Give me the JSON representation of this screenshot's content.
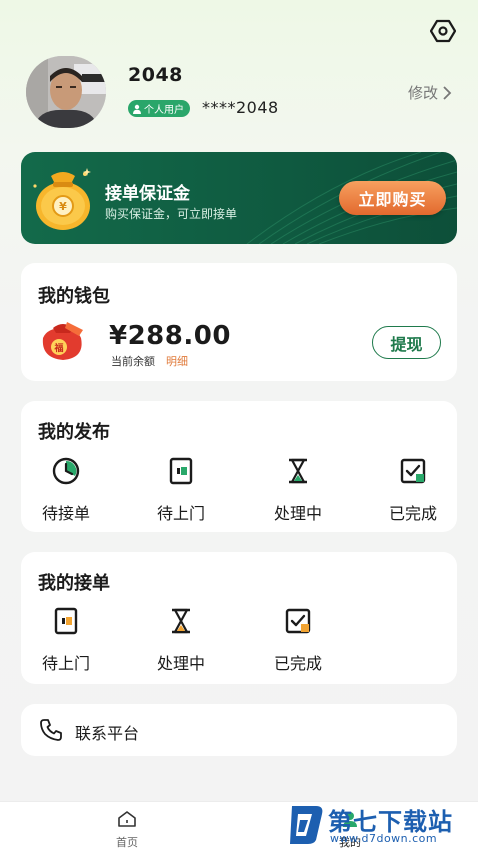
{
  "profile": {
    "name": "2048",
    "badge": "个人用户",
    "phone": "****2048",
    "edit_label": "修改"
  },
  "deposit_banner": {
    "title": "接单保证金",
    "subtitle": "购买保证金，可立即接单",
    "button_label": "立即购买"
  },
  "wallet": {
    "title": "我的钱包",
    "amount": "¥288.00",
    "balance_label": "当前余额",
    "detail_label": "明细",
    "withdraw_label": "提现"
  },
  "my_posts": {
    "title": "我的发布",
    "items": [
      {
        "label": "待接单",
        "icon": "clock-icon"
      },
      {
        "label": "待上门",
        "icon": "door-icon"
      },
      {
        "label": "处理中",
        "icon": "hourglass-icon"
      },
      {
        "label": "已完成",
        "icon": "check-box-icon"
      }
    ]
  },
  "my_orders": {
    "title": "我的接单",
    "items": [
      {
        "label": "待上门",
        "icon": "door-icon"
      },
      {
        "label": "处理中",
        "icon": "hourglass-icon"
      },
      {
        "label": "已完成",
        "icon": "check-box-icon"
      }
    ]
  },
  "contact": {
    "label": "联系平台",
    "icon": "phone-icon"
  },
  "tabbar": {
    "items": [
      {
        "label": "首页",
        "icon": "home-icon"
      },
      {
        "label": "我的",
        "icon": "user-icon"
      }
    ]
  },
  "watermark": {
    "title": "第七下载站",
    "url": "www.d7down.com"
  },
  "colors": {
    "brand_green": "#1f7a4c",
    "banner_green": "#136a4a",
    "accent_orange": "#e2692e",
    "badge_green": "#2aa66a"
  }
}
